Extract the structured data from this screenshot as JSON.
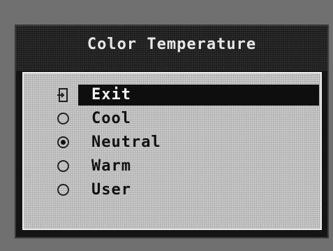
{
  "osd": {
    "title": "Color Temperature",
    "items": [
      {
        "label": "Exit",
        "icon": "exit-icon",
        "selected": true
      },
      {
        "label": "Cool",
        "icon": "radio-unchecked",
        "selected": false
      },
      {
        "label": "Neutral",
        "icon": "radio-checked",
        "selected": false
      },
      {
        "label": "Warm",
        "icon": "radio-unchecked",
        "selected": false
      },
      {
        "label": "User",
        "icon": "radio-unchecked",
        "selected": false
      }
    ]
  }
}
